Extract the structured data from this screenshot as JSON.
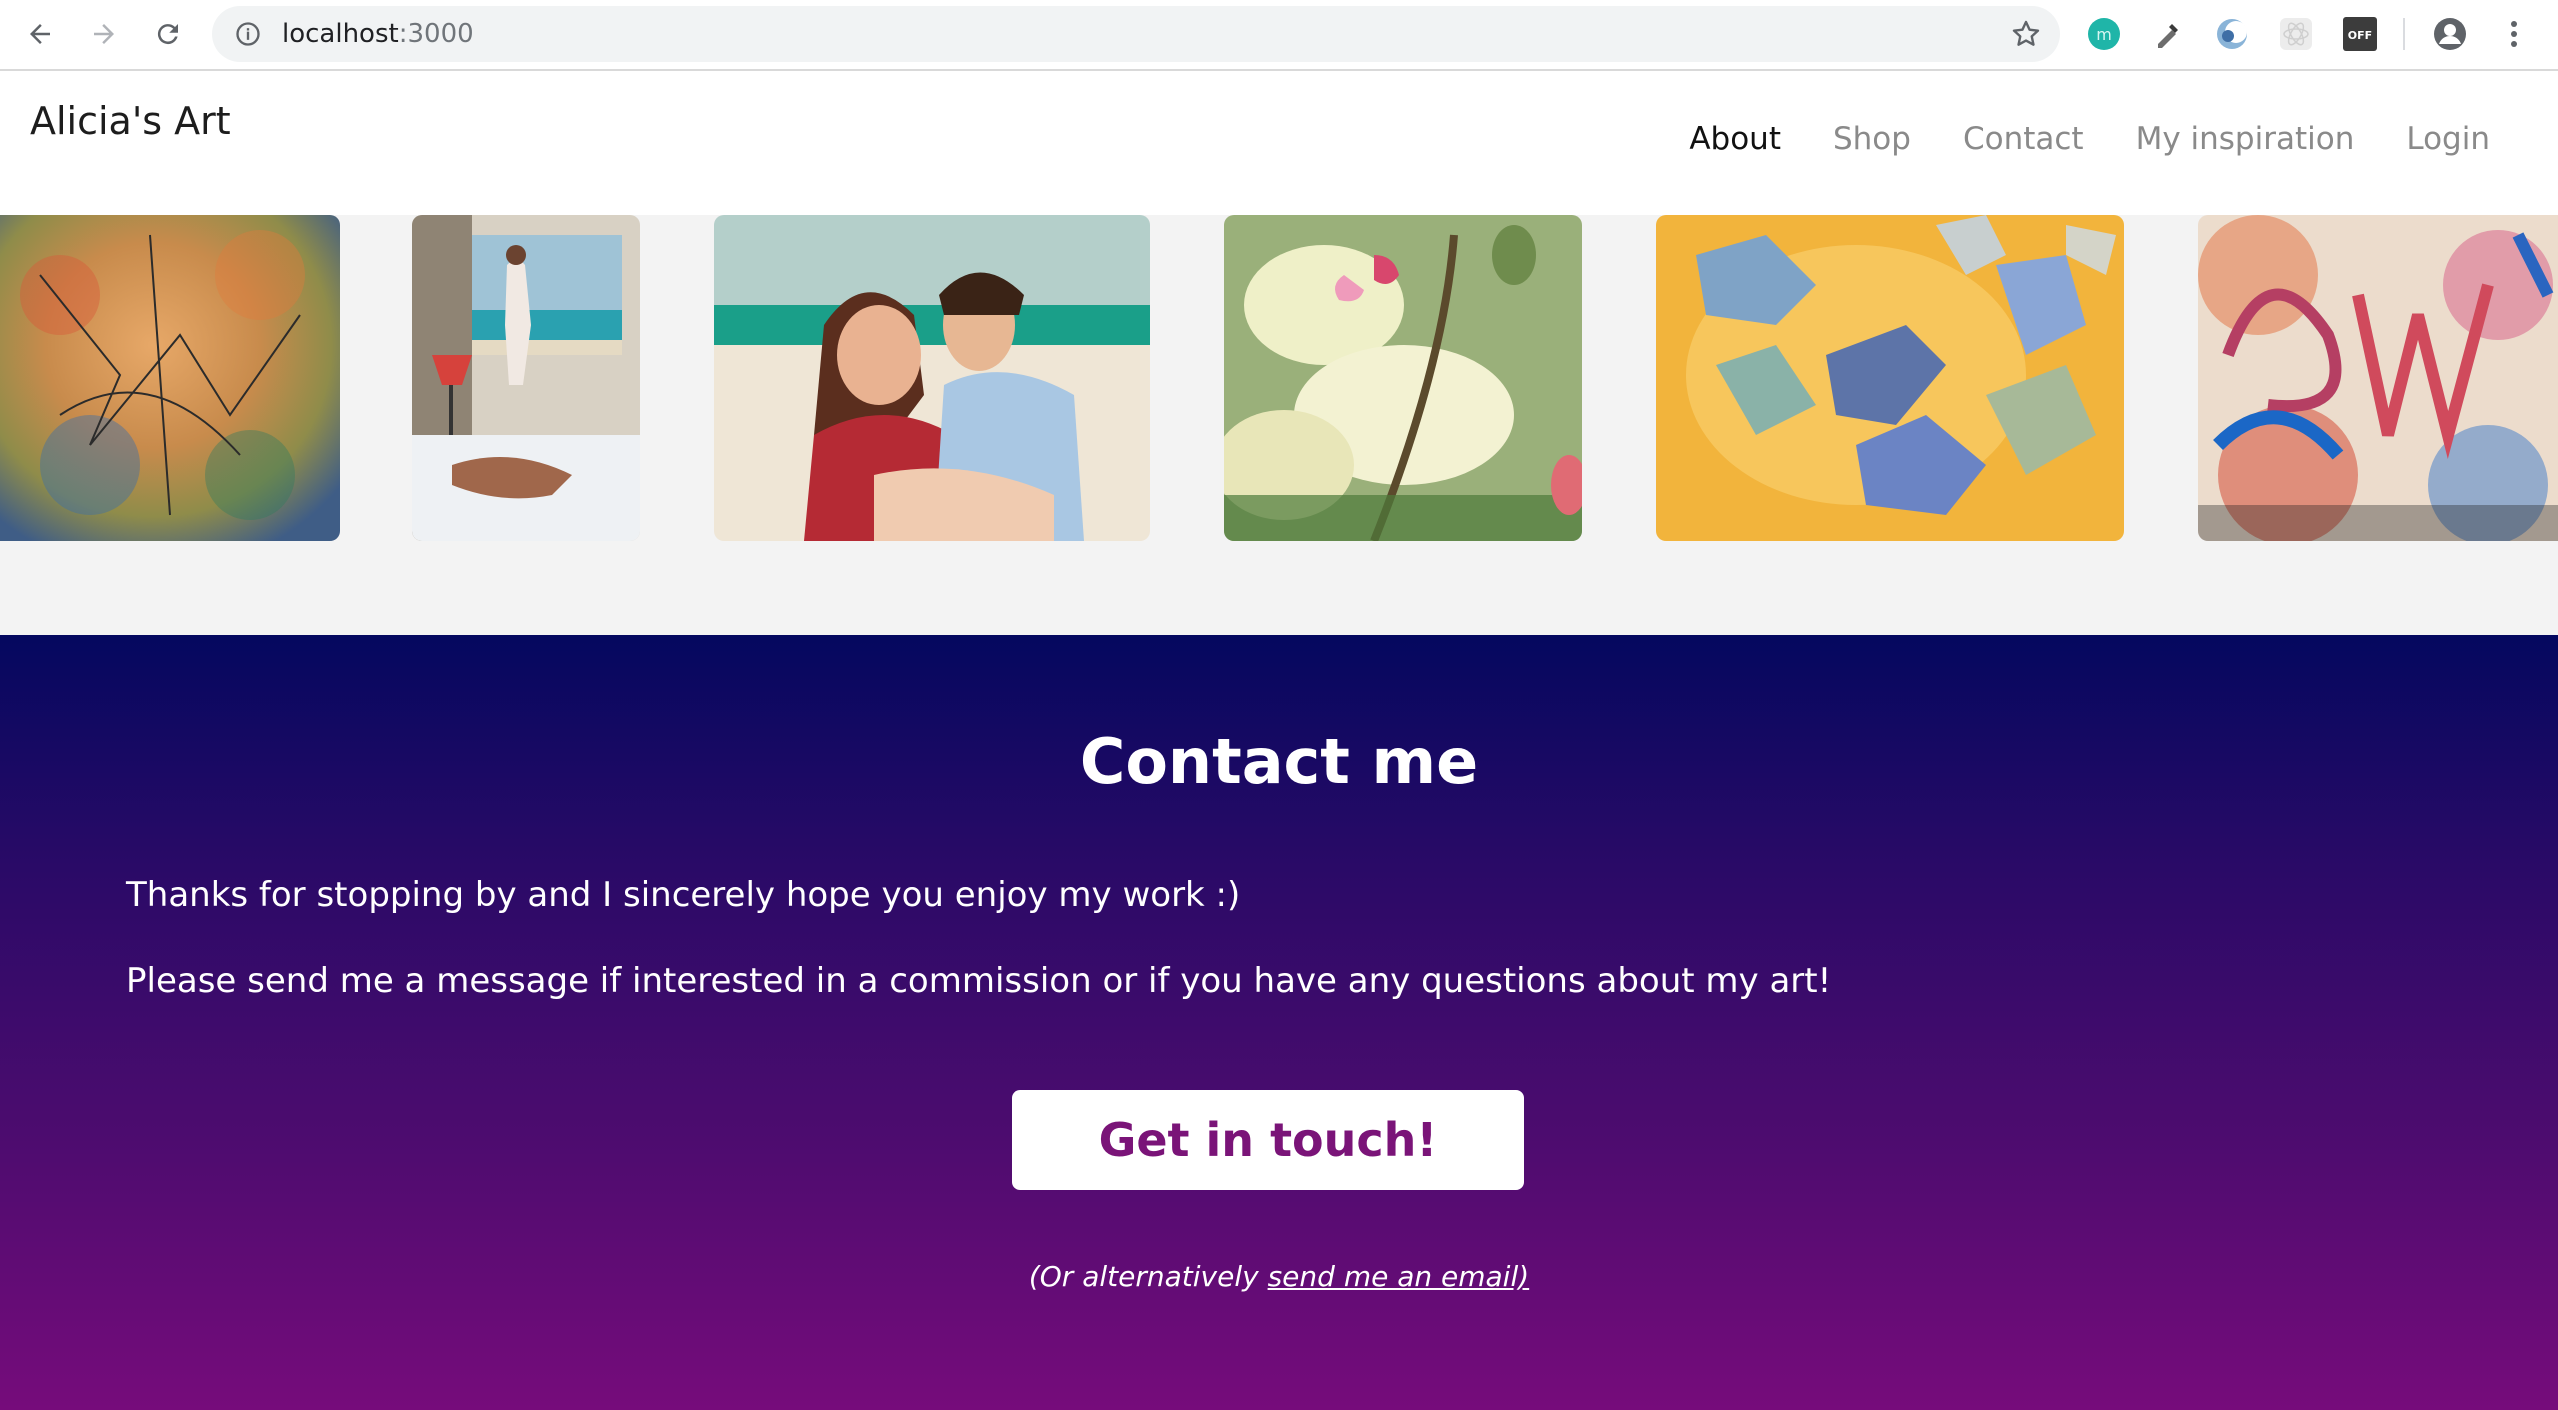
{
  "browser": {
    "url_host": "localhost",
    "url_port": ":3000"
  },
  "header": {
    "brand": "Alicia's Art",
    "nav": [
      {
        "label": "About",
        "active": true
      },
      {
        "label": "Shop"
      },
      {
        "label": "Contact"
      },
      {
        "label": "My inspiration"
      },
      {
        "label": "Login"
      }
    ]
  },
  "gallery": {
    "items": [
      {
        "name": "abstract-line-painting"
      },
      {
        "name": "woman-at-window-painting"
      },
      {
        "name": "couple-on-beach-painting"
      },
      {
        "name": "orchid-painting"
      },
      {
        "name": "blue-shapes-painting"
      },
      {
        "name": "graffiti-painting"
      }
    ]
  },
  "contact": {
    "title": "Contact me",
    "line1": "Thanks for stopping by and I sincerely hope you enjoy my work :)",
    "line2": "Please send me a message if interested in a commission or if you have any questions about my art!",
    "button": "Get in touch!",
    "alt_prefix": "(Or alternatively ",
    "alt_link": "send me an email)"
  },
  "colors": {
    "gradient_top": "#04085f",
    "gradient_bottom": "#760c7b",
    "button_text": "#7a1478"
  }
}
